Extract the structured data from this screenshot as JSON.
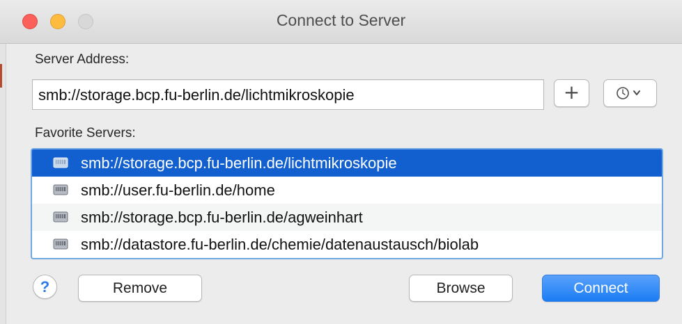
{
  "window": {
    "title": "Connect to Server"
  },
  "server_address": {
    "label": "Server Address:",
    "value": "smb://storage.bcp.fu-berlin.de/lichtmikroskopie"
  },
  "toolbar": {
    "add_label": "+",
    "history_icon": "clock-icon",
    "chevron_icon": "chevron-down-icon"
  },
  "favorites": {
    "label": "Favorite Servers:",
    "items": [
      {
        "label": "smb://storage.bcp.fu-berlin.de/lichtmikroskopie",
        "selected": true,
        "icon": "network-drive-icon"
      },
      {
        "label": "smb://user.fu-berlin.de/home",
        "selected": false,
        "icon": "network-drive-icon"
      },
      {
        "label": "smb://storage.bcp.fu-berlin.de/agweinhart",
        "selected": false,
        "icon": "network-drive-icon"
      },
      {
        "label": "smb://datastore.fu-berlin.de/chemie/datenaustausch/biolab",
        "selected": false,
        "icon": "network-drive-icon"
      }
    ]
  },
  "buttons": {
    "help_label": "?",
    "remove_label": "Remove",
    "browse_label": "Browse",
    "connect_label": "Connect"
  },
  "colors": {
    "selection": "#1260d0",
    "connect_button": "#1b7cf4",
    "close": "#fc605b",
    "minimize": "#fdbc40",
    "zoom_disabled": "#d8d8d8",
    "list_focus_ring": "#6fa6e4"
  }
}
